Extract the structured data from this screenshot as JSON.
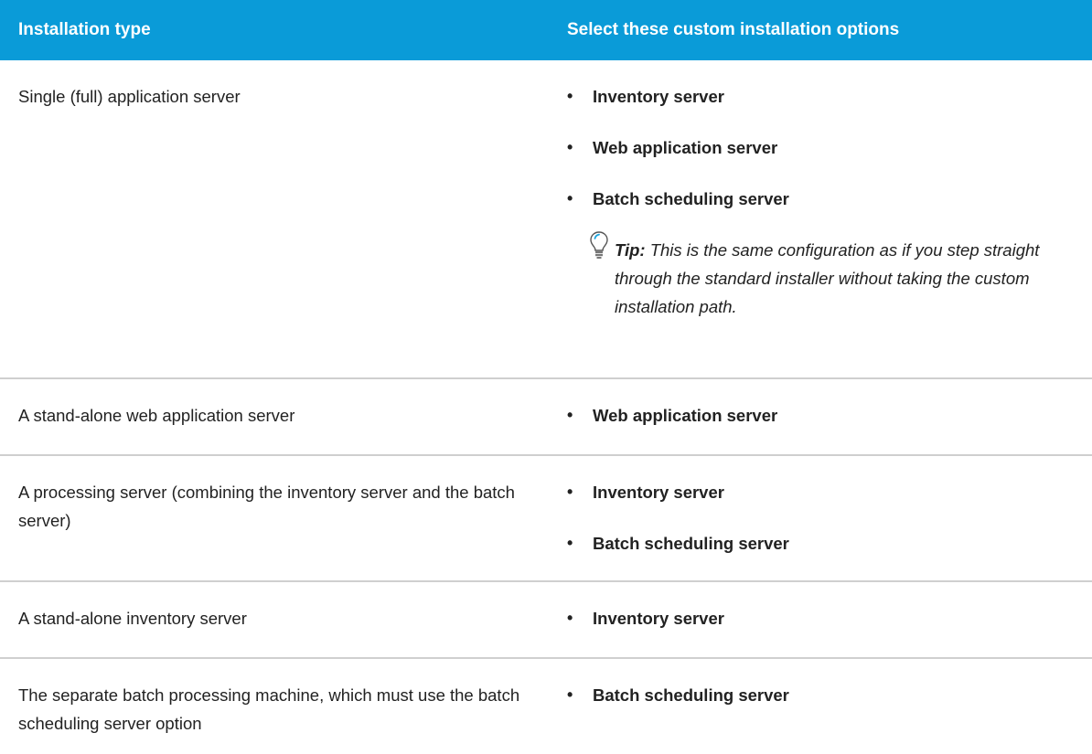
{
  "header": {
    "col1": "Installation type",
    "col2": "Select these custom installation options"
  },
  "rows": [
    {
      "type": "Single (full) application server",
      "options": [
        "Inventory server",
        "Web application server",
        "Batch scheduling server"
      ],
      "tip_label": "Tip:",
      "tip_text": "This is the same configuration as if you step straight through the standard installer without taking the custom installation path."
    },
    {
      "type": "A stand-alone web application server",
      "options": [
        "Web application server"
      ]
    },
    {
      "type": "A processing server (combining the inventory server and the batch server)",
      "options": [
        "Inventory server",
        "Batch scheduling server"
      ]
    },
    {
      "type": "A stand-alone inventory server",
      "options": [
        "Inventory server"
      ]
    },
    {
      "type": "The separate batch processing machine, which must use the batch scheduling server option",
      "options": [
        "Batch scheduling server"
      ]
    }
  ],
  "bullet": "•",
  "icons": {
    "tip": "lightbulb-icon"
  },
  "colors": {
    "header_bg": "#0a9bd8",
    "header_text": "#ffffff",
    "divider": "#cfcfcf"
  }
}
